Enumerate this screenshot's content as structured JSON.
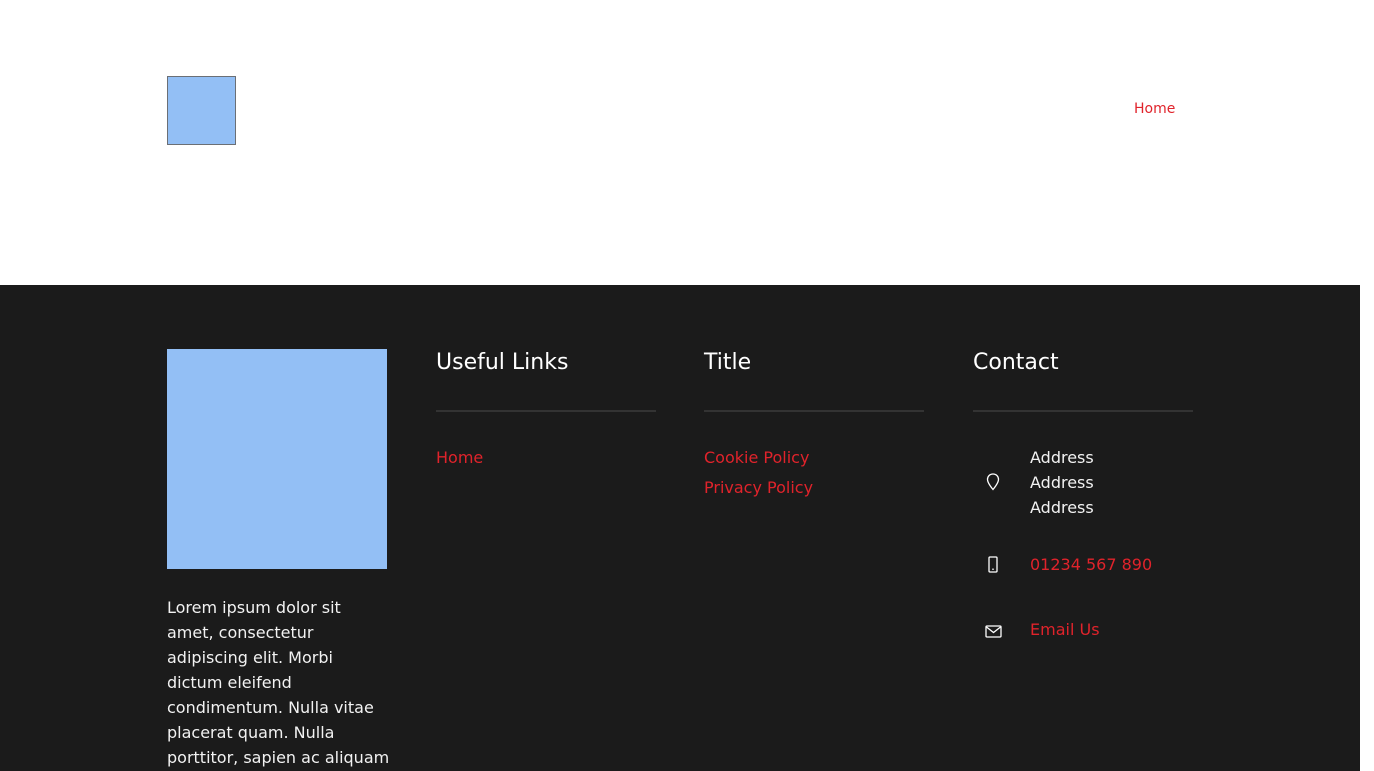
{
  "header": {
    "nav": {
      "home_label": "Home"
    }
  },
  "footer": {
    "about_text": "Lorem ipsum dolor sit amet, consectetur adipiscing elit. Morbi dictum eleifend condimentum. Nulla vitae placerat quam. Nulla porttitor, sapien ac aliquam mattis, dui massa interdum",
    "useful_links": {
      "title": "Useful Links",
      "items": [
        {
          "label": "Home"
        }
      ]
    },
    "title_column": {
      "title": "Title",
      "items": [
        {
          "label": "Cookie Policy"
        },
        {
          "label": "Privacy Policy"
        }
      ]
    },
    "contact": {
      "title": "Contact",
      "address_lines": [
        "Address",
        "Address",
        "Address"
      ],
      "phone": "01234 567 890",
      "email_label": "Email Us",
      "icons": {
        "address": "map-pin-icon",
        "phone": "mobile-phone-icon",
        "email": "envelope-icon"
      }
    }
  },
  "colors": {
    "accent": "#e0232b",
    "footer_bg": "#1b1b1b",
    "placeholder_image": "#93bff5"
  }
}
